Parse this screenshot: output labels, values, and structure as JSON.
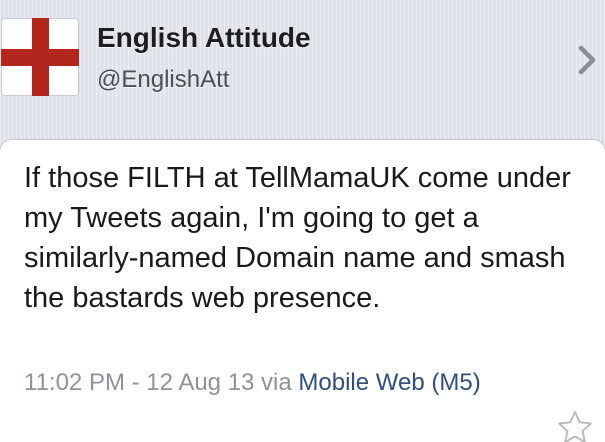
{
  "profile": {
    "name": "English Attitude",
    "handle": "@EnglishAtt",
    "avatar": "england-flag-icon",
    "disclosure_icon": "chevron-right-icon"
  },
  "tweet": {
    "text": "If those FILTH at TellMamaUK come under my Tweets again, I'm going to get a similarly-named Domain name and smash the bastards web presence.",
    "time": "11:02 PM",
    "separator": " - ",
    "date": "12 Aug 13",
    "via_label": " via ",
    "source": "Mobile Web (M5)",
    "favorite_icon": "star-icon"
  },
  "colors": {
    "background": "#dfe3e9",
    "flag_red": "#b3261e",
    "link": "#2f4f7e",
    "meta_text": "#8e939a"
  }
}
